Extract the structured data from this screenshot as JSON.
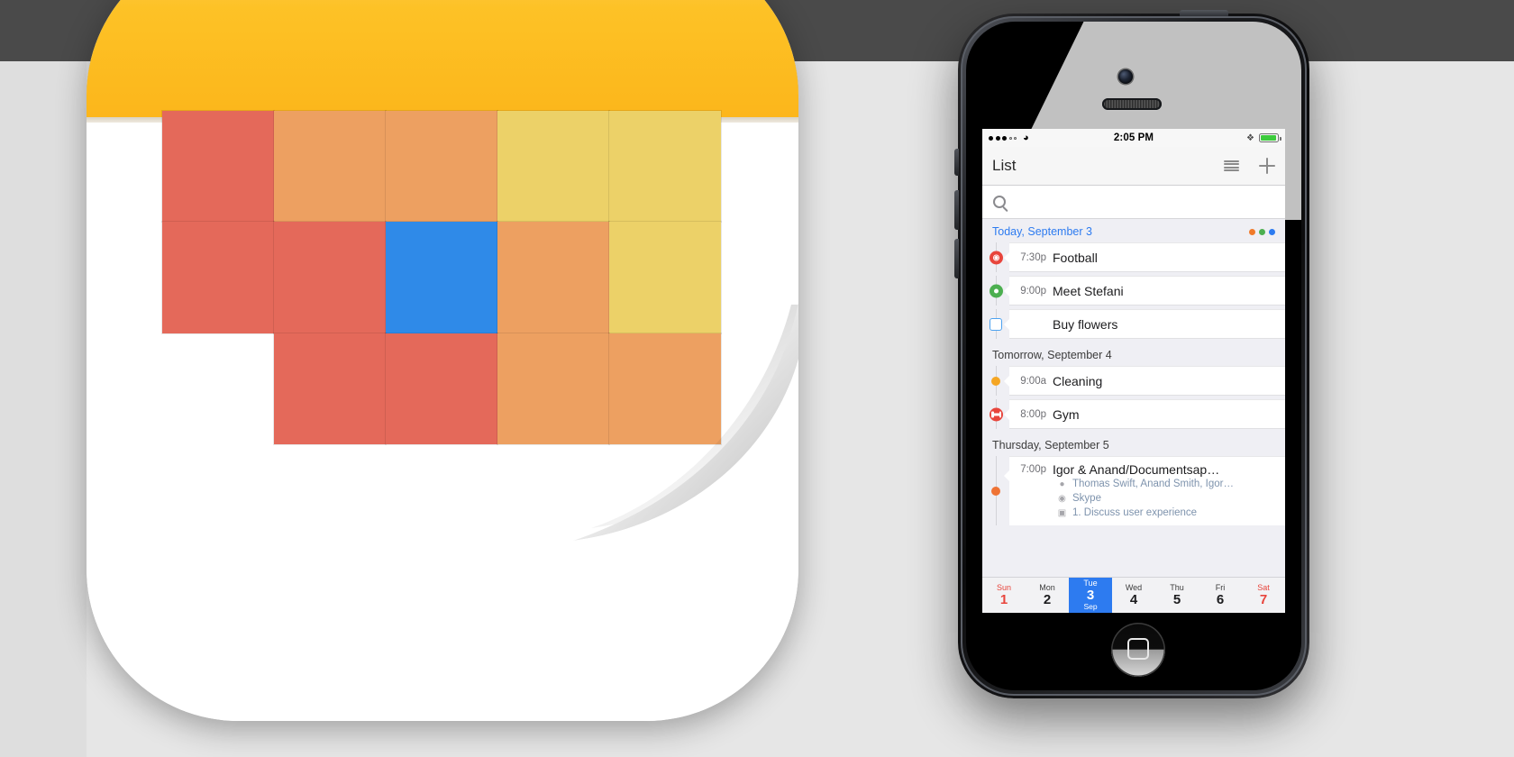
{
  "app_icon": {
    "name": "calendar-app-icon",
    "header_color": "#fcc024",
    "grid": {
      "cols": 5,
      "rows": 3,
      "cell_colors": [
        [
          "#e4695a",
          "#eda061",
          "#eda061",
          "#ecd168",
          "#ecd168"
        ],
        [
          "#e4695a",
          "#e4695a",
          "#2f8ae8",
          "#eda061",
          "#ecd168"
        ],
        [
          null,
          "#e4695a",
          "#e4695a",
          "#eda061",
          "#eda061"
        ]
      ],
      "selected_cell": {
        "row": 1,
        "col": 2,
        "color": "#2f8ae8"
      }
    }
  },
  "phone": {
    "status_bar": {
      "signal_dots_filled": 3,
      "signal_dots_total": 5,
      "wifi_icon": "wifi-icon",
      "time": "2:05 PM",
      "bluetooth_icon": "bluetooth-icon",
      "battery_icon": "battery-icon",
      "battery_color": "#3ccb3c"
    },
    "nav_bar": {
      "title": "List",
      "list_icon": "list-lines-icon",
      "add_icon": "plus-icon"
    },
    "search": {
      "icon": "search-icon",
      "value": "",
      "placeholder": ""
    },
    "sections": [
      {
        "title": "Today, September 3",
        "is_today": true,
        "dots": [
          "#f07a2a",
          "#4caf50",
          "#2d7bf0"
        ],
        "rows": [
          {
            "bullet": "soccer-ball-icon",
            "bullet_color": "#e8453c",
            "bullet_type": "soccer",
            "time": "7:30p",
            "title": "Football"
          },
          {
            "bullet": "location-pin-icon",
            "bullet_color": "#4caf50",
            "bullet_type": "pin",
            "time": "9:00p",
            "title": "Meet Stefani"
          },
          {
            "bullet": "checkbox-icon",
            "bullet_color": "#4da2f0",
            "bullet_type": "checkbox",
            "time": "",
            "title": "Buy flowers"
          }
        ]
      },
      {
        "title": "Tomorrow, September 4",
        "is_today": false,
        "dots": [],
        "rows": [
          {
            "bullet": "dot-icon",
            "bullet_color": "#f5a623",
            "bullet_type": "dot",
            "time": "9:00a",
            "title": "Cleaning"
          },
          {
            "bullet": "dumbbell-icon",
            "bullet_color": "#e8453c",
            "bullet_type": "gym",
            "time": "8:00p",
            "title": "Gym"
          }
        ]
      },
      {
        "title": "Thursday, September 5",
        "is_today": false,
        "dots": [],
        "rows": [
          {
            "bullet": "dot-icon",
            "bullet_color": "#ef7335",
            "bullet_type": "dot",
            "time": "7:00p",
            "title": "Igor & Anand/Documentsap…",
            "details": [
              {
                "icon": "person-icon",
                "text": "Thomas Swift, Anand Smith, Igor…"
              },
              {
                "icon": "location-pin-icon",
                "text": "Skype"
              },
              {
                "icon": "note-icon",
                "text": "1. Discuss user experience"
              }
            ]
          }
        ]
      }
    ],
    "week_bar": {
      "days": [
        {
          "dow": "Sun",
          "num": "1",
          "month": "",
          "weekend": true,
          "selected": false
        },
        {
          "dow": "Mon",
          "num": "2",
          "month": "",
          "weekend": false,
          "selected": false
        },
        {
          "dow": "Tue",
          "num": "3",
          "month": "Sep",
          "weekend": false,
          "selected": true
        },
        {
          "dow": "Wed",
          "num": "4",
          "month": "",
          "weekend": false,
          "selected": false
        },
        {
          "dow": "Thu",
          "num": "5",
          "month": "",
          "weekend": false,
          "selected": false
        },
        {
          "dow": "Fri",
          "num": "6",
          "month": "",
          "weekend": false,
          "selected": false
        },
        {
          "dow": "Sat",
          "num": "7",
          "month": "",
          "weekend": true,
          "selected": false
        }
      ]
    },
    "home_button": "home-button"
  }
}
